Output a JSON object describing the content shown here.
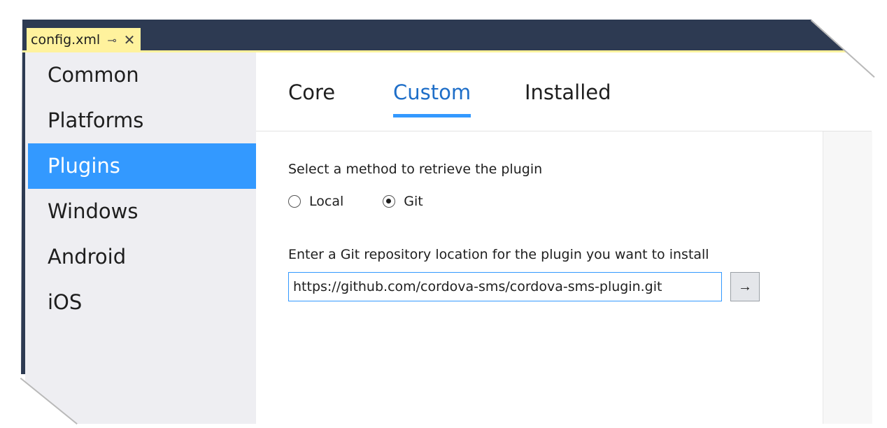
{
  "window": {
    "tab_label": "config.xml",
    "pin_glyph": "⊸",
    "close_glyph": "✕"
  },
  "sidebar": {
    "items": [
      {
        "label": "Common",
        "active": false
      },
      {
        "label": "Platforms",
        "active": false
      },
      {
        "label": "Plugins",
        "active": true
      },
      {
        "label": "Windows",
        "active": false
      },
      {
        "label": "Android",
        "active": false
      },
      {
        "label": "iOS",
        "active": false
      }
    ]
  },
  "plugin_tabs": [
    {
      "label": "Core",
      "active": false
    },
    {
      "label": "Custom",
      "active": true
    },
    {
      "label": "Installed",
      "active": false
    }
  ],
  "custom": {
    "method_prompt": "Select a method to retrieve the plugin",
    "options": [
      {
        "label": "Local",
        "selected": false
      },
      {
        "label": "Git",
        "selected": true
      }
    ],
    "repo_prompt": "Enter a Git repository location for the plugin you want to install",
    "repo_value": "https://github.com/cordova-sms/cordova-sms-plugin.git",
    "go_glyph": "→"
  },
  "colors": {
    "title_bar": "#2d3a52",
    "tab_highlight": "#fff29d",
    "accent": "#3399ff",
    "sidebar_bg": "#eeeef2"
  },
  "icons": {
    "pin": "pin-icon",
    "close": "close-icon",
    "go": "arrow-right-icon"
  }
}
